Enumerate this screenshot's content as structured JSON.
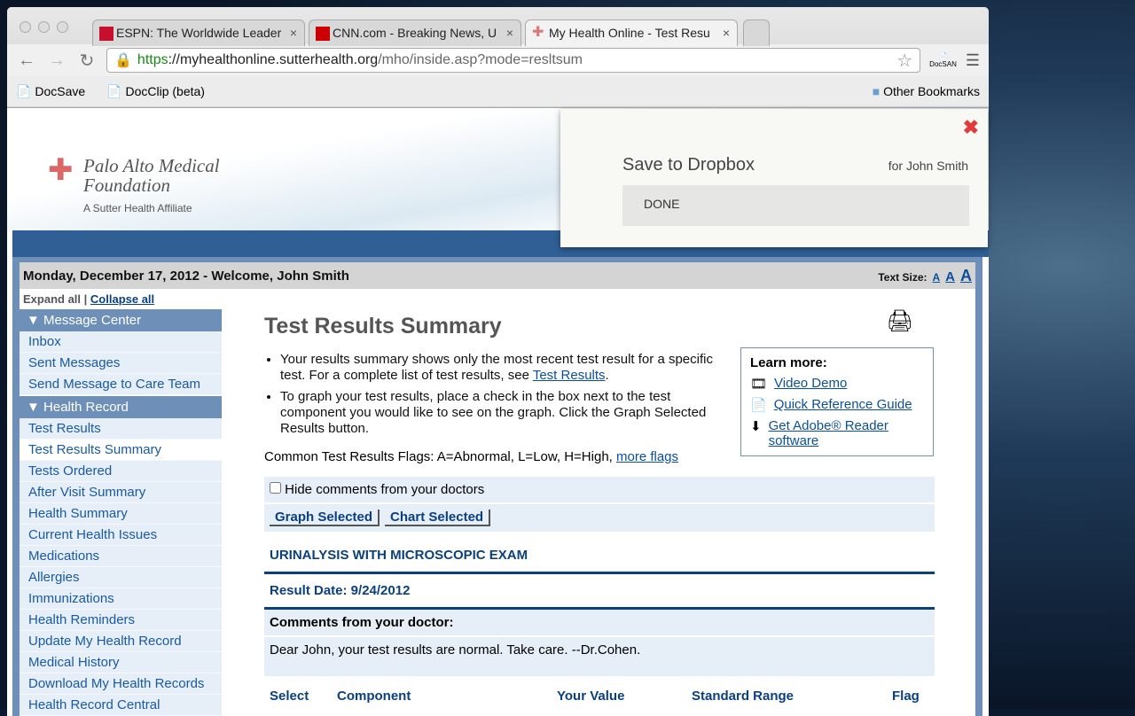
{
  "browser": {
    "tabs": [
      {
        "title": "ESPN: The Worldwide Leader",
        "active": false
      },
      {
        "title": "CNN.com - Breaking News, U",
        "active": false
      },
      {
        "title": "My Health Online - Test Resu",
        "active": true
      }
    ],
    "url": {
      "scheme": "https",
      "host": "://myhealthonline.sutterhealth.org",
      "path": "/mho/inside.asp?mode=resltsum"
    },
    "extension_label": "DocSAN",
    "bookmarks": [
      "DocSave",
      "DocClip (beta)"
    ],
    "other_bookmarks": "Other Bookmarks"
  },
  "logo": {
    "line1": "Palo Alto Medical",
    "line2": "Foundation",
    "tagline": "A Sutter Health Affiliate"
  },
  "dropbox": {
    "title": "Save to Dropbox",
    "user": "for John Smith",
    "status": "DONE"
  },
  "header": {
    "welcome": "Monday, December 17, 2012 - Welcome, John Smith",
    "text_size_label": "Text Size:",
    "sizes": [
      "A",
      "A",
      "A"
    ]
  },
  "expand": {
    "expand": "Expand all",
    "sep": " | ",
    "collapse": "Collapse all"
  },
  "sidebar": {
    "sections": [
      {
        "title": "Message Center",
        "items": [
          "Inbox",
          "Sent Messages",
          "Send Message to Care Team"
        ]
      },
      {
        "title": "Health Record",
        "items": [
          "Test Results",
          "Test Results Summary",
          "Tests Ordered",
          "After Visit Summary",
          "Health Summary",
          "Current Health Issues",
          "Medications",
          "Allergies",
          "Immunizations",
          "Health Reminders",
          "Update My Health Record",
          "Medical History",
          "Download My Health Records",
          "Health Record Central"
        ]
      }
    ],
    "selected": "Test Results Summary"
  },
  "main": {
    "title": "Test Results Summary",
    "bullet1": "Your results summary shows only the most recent test result for a specific test. For a complete list of test results, see ",
    "bullet1_link": "Test Results",
    "bullet1_end": ".",
    "bullet2": "To graph your test results, place a check in the box next to the test component you would like to see on the graph. Click the Graph Selected Results button.",
    "flags": "Common Test Results Flags: A=Abnormal, L=Low, H=High, ",
    "flags_link": "more flags",
    "learn": {
      "title": "Learn more:",
      "links": [
        "Video Demo",
        "Quick Reference Guide",
        "Get Adobe® Reader software"
      ]
    },
    "hide_comments": "Hide comments from your doctors",
    "hide_checked": false,
    "graph_btn": "Graph Selected",
    "chart_btn": "Chart Selected",
    "test_name": "URINALYSIS WITH MICROSCOPIC EXAM",
    "result_date": "Result Date: 9/24/2012",
    "comments_title": "Comments from your doctor:",
    "comment": "Dear John, your test results are normal. Take care. --Dr.Cohen.",
    "columns": [
      "Select",
      "Component",
      "Your Value",
      "Standard Range",
      "Flag"
    ]
  }
}
